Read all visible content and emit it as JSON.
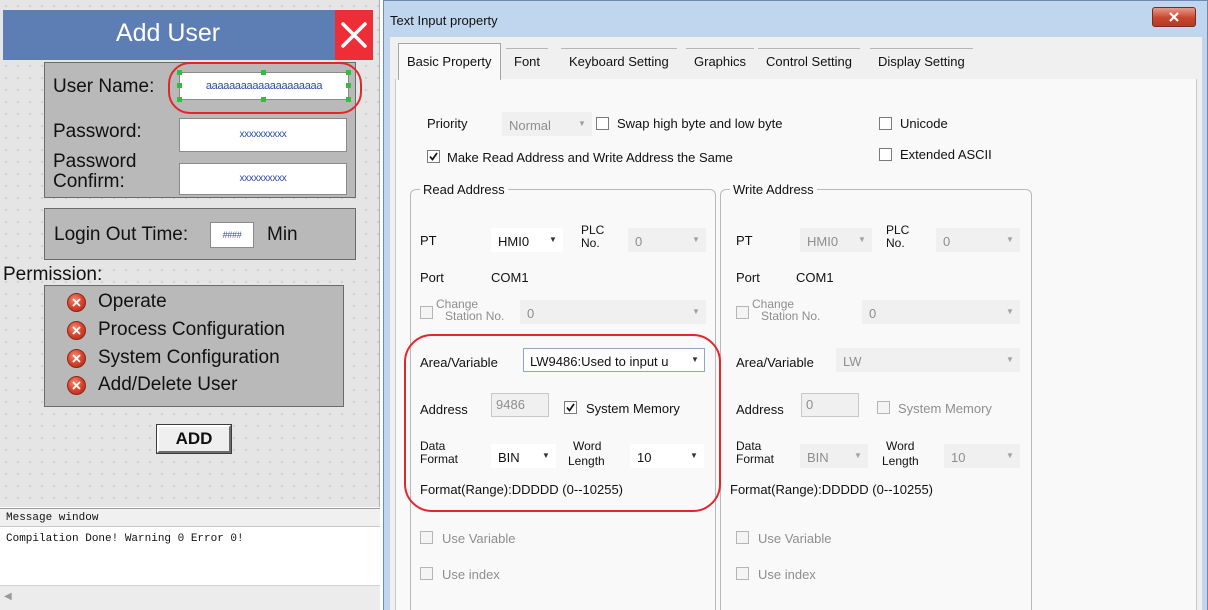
{
  "hmi": {
    "title": "Add User",
    "user_name_label": "User Name:",
    "user_name_value": "aaaaaaaaaaaaaaaaaaaa",
    "password_label": "Password:",
    "password_value": "xxxxxxxxxx",
    "password_confirm_label_1": "Password",
    "password_confirm_label_2": "Confirm:",
    "password_confirm_value": "xxxxxxxxxx",
    "login_out_label": "Login Out Time:",
    "login_out_value": "####",
    "login_out_unit": "Min",
    "permission_label": "Permission:",
    "permissions": [
      "Operate",
      "Process Configuration",
      "System Configuration",
      "Add/Delete User"
    ],
    "add_button": "ADD"
  },
  "message_window": {
    "header": "Message window",
    "text": "Compilation Done! Warning 0 Error 0!"
  },
  "dialog": {
    "title": "Text Input property",
    "tabs": [
      "Basic Property",
      "Font",
      "Keyboard Setting",
      "Graphics",
      "Control Setting",
      "Display Setting"
    ],
    "active_tab": "Basic Property",
    "priority_label": "Priority",
    "priority_value": "Normal",
    "swap_bytes_label": "Swap high byte and low byte",
    "unicode_label": "Unicode",
    "same_address_label": "Make Read Address and Write Address the Same",
    "same_address_checked": true,
    "extended_ascii_label": "Extended ASCII",
    "read": {
      "title": "Read Address",
      "pt_label": "PT",
      "pt_value": "HMI0",
      "plc_label_1": "PLC",
      "plc_label_2": "No.",
      "plc_value": "0",
      "port_label": "Port",
      "port_value": "COM1",
      "change_label_1": "Change",
      "change_label_2": "Station No.",
      "change_value": "0",
      "area_label": "Area/Variable",
      "area_value": "LW9486:Used to input u",
      "address_label": "Address",
      "address_value": "9486",
      "system_memory_label": "System Memory",
      "system_memory_checked": true,
      "data_label_1": "Data",
      "data_label_2": "Format",
      "data_value": "BIN",
      "word_label_1": "Word",
      "word_label_2": "Length",
      "word_value": "10",
      "format_range": "Format(Range):DDDDD (0--10255)",
      "use_variable_label": "Use Variable",
      "use_index_label": "Use index"
    },
    "write": {
      "title": "Write Address",
      "pt_label": "PT",
      "pt_value": "HMI0",
      "plc_label_1": "PLC",
      "plc_label_2": "No.",
      "plc_value": "0",
      "port_label": "Port",
      "port_value": "COM1",
      "change_label_1": "Change",
      "change_label_2": "Station No.",
      "change_value": "0",
      "area_label": "Area/Variable",
      "area_value": "LW",
      "address_label": "Address",
      "address_value": "0",
      "system_memory_label": "System Memory",
      "data_label_1": "Data",
      "data_label_2": "Format",
      "data_value": "BIN",
      "word_label_1": "Word",
      "word_label_2": "Length",
      "word_value": "10",
      "format_range": "Format(Range):DDDDD (0--10255)",
      "use_variable_label": "Use Variable",
      "use_index_label": "Use index"
    }
  },
  "colors": {
    "hmi_title_bar": "#5d7db5",
    "hmi_close": "#ef2d36",
    "highlight_red": "#e3262b",
    "dialog_frame": "#c0d6ee",
    "handle_green": "#2fbf3a"
  }
}
